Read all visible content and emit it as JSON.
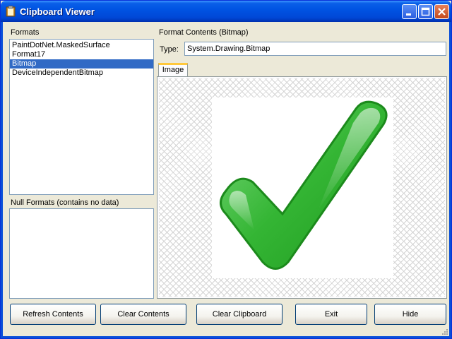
{
  "window": {
    "title": "Clipboard Viewer",
    "icon": "clipboard-icon",
    "controls": [
      "minimize-icon",
      "maximize-icon",
      "close-icon"
    ]
  },
  "formats": {
    "label": "Formats",
    "items": [
      "PaintDotNet.MaskedSurface",
      "Format17",
      "Bitmap",
      "DeviceIndependentBitmap"
    ],
    "selected": "Bitmap"
  },
  "null_formats": {
    "label": "Null Formats (contains no data)",
    "items": []
  },
  "contents": {
    "label": "Format Contents (Bitmap)",
    "type_label": "Type:",
    "type_value": "System.Drawing.Bitmap",
    "tab_label": "Image",
    "image": "green-checkmark-icon"
  },
  "buttons": {
    "refresh": "Refresh Contents",
    "clear_contents": "Clear Contents",
    "clear_clipboard": "Clear Clipboard",
    "exit": "Exit",
    "hide": "Hide"
  },
  "colors": {
    "title_bar": "#0054e3",
    "selection": "#316ac5",
    "check_green": "#2db52d"
  }
}
